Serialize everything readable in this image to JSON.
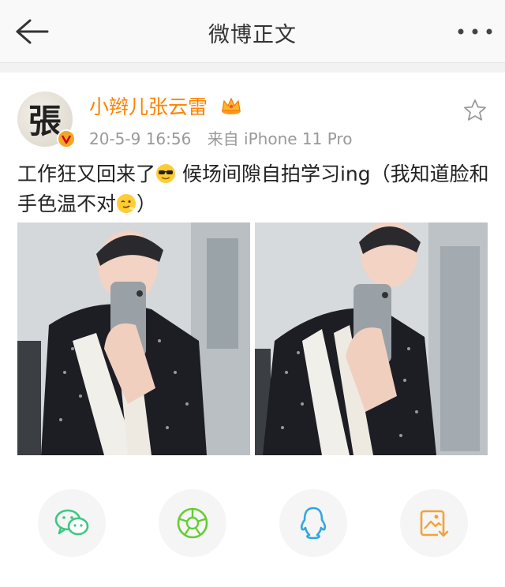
{
  "header": {
    "title": "微博正文",
    "back_icon": "back-arrow-icon",
    "more_icon": "more-dots-icon"
  },
  "post": {
    "author": "小辫儿张云雷",
    "avatar_glyph": "張",
    "date": "20-5-9 16:56",
    "source": "来自 iPhone 11 Pro",
    "text_part1": "工作狂又回来了",
    "text_part2": " 候场间隙自拍学习ing（我知道脸和手色温不对",
    "text_part3": "）",
    "emoji1": "sunglasses-emoji-icon",
    "emoji2": "wink-emoji-icon",
    "images": [
      "mirror-selfie-1",
      "mirror-selfie-2"
    ]
  },
  "share": {
    "items": [
      "wechat-icon",
      "moments-icon",
      "qq-icon",
      "save-image-icon"
    ]
  },
  "colors": {
    "username": "#ff8200",
    "meta": "#999999",
    "wechat": "#3cc883",
    "moments": "#66cc33",
    "qq": "#2ea7e0",
    "save": "#f2a33a"
  }
}
